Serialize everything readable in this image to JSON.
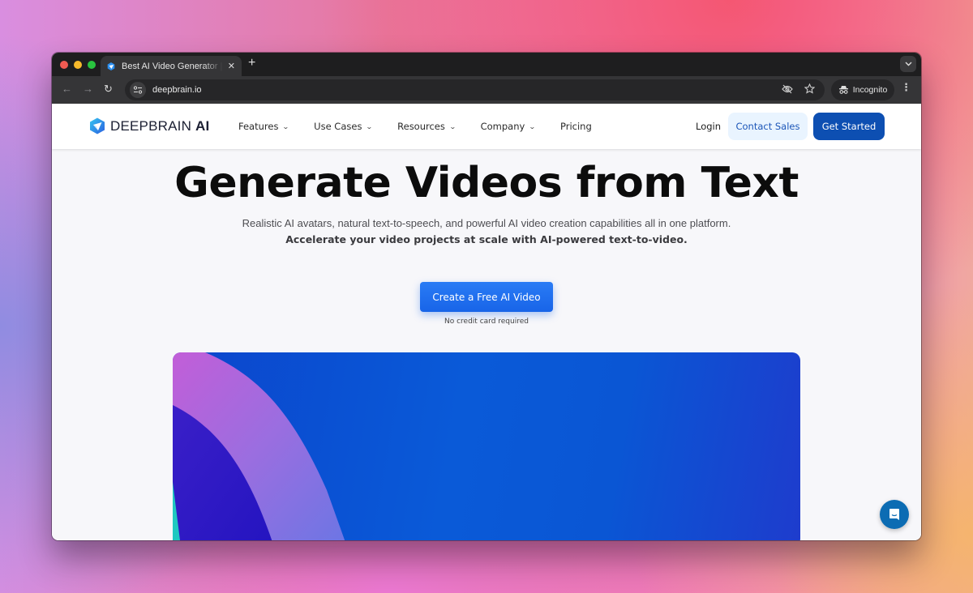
{
  "browser": {
    "tab_title": "Best AI Video Generator | DeepBrain AI",
    "tab_close": "✕",
    "new_tab": "+",
    "url": "deepbrain.io",
    "incognito_label": "Incognito",
    "icons": {
      "back": "←",
      "forward": "→",
      "reload": "↻",
      "tab_menu": "⌄",
      "kebab": "⋮"
    }
  },
  "site": {
    "logo": {
      "name": "DEEPBRAIN",
      "suffix": "AI"
    },
    "nav": [
      {
        "label": "Features",
        "dropdown": true
      },
      {
        "label": "Use Cases",
        "dropdown": true
      },
      {
        "label": "Resources",
        "dropdown": true
      },
      {
        "label": "Company",
        "dropdown": true
      },
      {
        "label": "Pricing",
        "dropdown": false
      }
    ],
    "chevron": "⌄",
    "login": "Login",
    "contact_sales": "Contact Sales",
    "get_started": "Get Started"
  },
  "hero": {
    "title": "Generate Videos from Text",
    "subtitle_line1": "Realistic AI avatars, natural text-to-speech, and powerful AI video creation capabilities all in one platform.",
    "subtitle_line2": "Accelerate your video projects at scale with AI-powered text-to-video.",
    "cta": "Create a Free AI Video",
    "cta_note": "No credit card required"
  },
  "colors": {
    "brand_blue": "#0d4fb2",
    "cta_blue": "#1f6ff0",
    "contact_bg": "#e9f4ff",
    "chat_blue": "#0c6cb3"
  }
}
